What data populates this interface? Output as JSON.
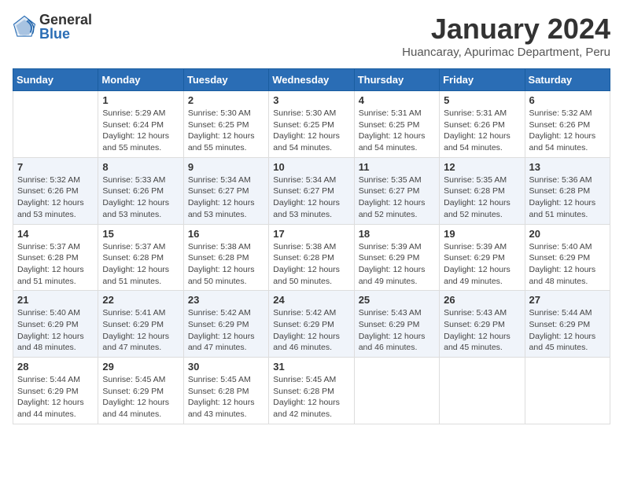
{
  "logo": {
    "general": "General",
    "blue": "Blue"
  },
  "title": "January 2024",
  "subtitle": "Huancaray, Apurimac Department, Peru",
  "days_of_week": [
    "Sunday",
    "Monday",
    "Tuesday",
    "Wednesday",
    "Thursday",
    "Friday",
    "Saturday"
  ],
  "weeks": [
    [
      {
        "day": "",
        "info": ""
      },
      {
        "day": "1",
        "info": "Sunrise: 5:29 AM\nSunset: 6:24 PM\nDaylight: 12 hours\nand 55 minutes."
      },
      {
        "day": "2",
        "info": "Sunrise: 5:30 AM\nSunset: 6:25 PM\nDaylight: 12 hours\nand 55 minutes."
      },
      {
        "day": "3",
        "info": "Sunrise: 5:30 AM\nSunset: 6:25 PM\nDaylight: 12 hours\nand 54 minutes."
      },
      {
        "day": "4",
        "info": "Sunrise: 5:31 AM\nSunset: 6:25 PM\nDaylight: 12 hours\nand 54 minutes."
      },
      {
        "day": "5",
        "info": "Sunrise: 5:31 AM\nSunset: 6:26 PM\nDaylight: 12 hours\nand 54 minutes."
      },
      {
        "day": "6",
        "info": "Sunrise: 5:32 AM\nSunset: 6:26 PM\nDaylight: 12 hours\nand 54 minutes."
      }
    ],
    [
      {
        "day": "7",
        "info": "Sunrise: 5:32 AM\nSunset: 6:26 PM\nDaylight: 12 hours\nand 53 minutes."
      },
      {
        "day": "8",
        "info": "Sunrise: 5:33 AM\nSunset: 6:26 PM\nDaylight: 12 hours\nand 53 minutes."
      },
      {
        "day": "9",
        "info": "Sunrise: 5:34 AM\nSunset: 6:27 PM\nDaylight: 12 hours\nand 53 minutes."
      },
      {
        "day": "10",
        "info": "Sunrise: 5:34 AM\nSunset: 6:27 PM\nDaylight: 12 hours\nand 53 minutes."
      },
      {
        "day": "11",
        "info": "Sunrise: 5:35 AM\nSunset: 6:27 PM\nDaylight: 12 hours\nand 52 minutes."
      },
      {
        "day": "12",
        "info": "Sunrise: 5:35 AM\nSunset: 6:28 PM\nDaylight: 12 hours\nand 52 minutes."
      },
      {
        "day": "13",
        "info": "Sunrise: 5:36 AM\nSunset: 6:28 PM\nDaylight: 12 hours\nand 51 minutes."
      }
    ],
    [
      {
        "day": "14",
        "info": "Sunrise: 5:37 AM\nSunset: 6:28 PM\nDaylight: 12 hours\nand 51 minutes."
      },
      {
        "day": "15",
        "info": "Sunrise: 5:37 AM\nSunset: 6:28 PM\nDaylight: 12 hours\nand 51 minutes."
      },
      {
        "day": "16",
        "info": "Sunrise: 5:38 AM\nSunset: 6:28 PM\nDaylight: 12 hours\nand 50 minutes."
      },
      {
        "day": "17",
        "info": "Sunrise: 5:38 AM\nSunset: 6:28 PM\nDaylight: 12 hours\nand 50 minutes."
      },
      {
        "day": "18",
        "info": "Sunrise: 5:39 AM\nSunset: 6:29 PM\nDaylight: 12 hours\nand 49 minutes."
      },
      {
        "day": "19",
        "info": "Sunrise: 5:39 AM\nSunset: 6:29 PM\nDaylight: 12 hours\nand 49 minutes."
      },
      {
        "day": "20",
        "info": "Sunrise: 5:40 AM\nSunset: 6:29 PM\nDaylight: 12 hours\nand 48 minutes."
      }
    ],
    [
      {
        "day": "21",
        "info": "Sunrise: 5:40 AM\nSunset: 6:29 PM\nDaylight: 12 hours\nand 48 minutes."
      },
      {
        "day": "22",
        "info": "Sunrise: 5:41 AM\nSunset: 6:29 PM\nDaylight: 12 hours\nand 47 minutes."
      },
      {
        "day": "23",
        "info": "Sunrise: 5:42 AM\nSunset: 6:29 PM\nDaylight: 12 hours\nand 47 minutes."
      },
      {
        "day": "24",
        "info": "Sunrise: 5:42 AM\nSunset: 6:29 PM\nDaylight: 12 hours\nand 46 minutes."
      },
      {
        "day": "25",
        "info": "Sunrise: 5:43 AM\nSunset: 6:29 PM\nDaylight: 12 hours\nand 46 minutes."
      },
      {
        "day": "26",
        "info": "Sunrise: 5:43 AM\nSunset: 6:29 PM\nDaylight: 12 hours\nand 45 minutes."
      },
      {
        "day": "27",
        "info": "Sunrise: 5:44 AM\nSunset: 6:29 PM\nDaylight: 12 hours\nand 45 minutes."
      }
    ],
    [
      {
        "day": "28",
        "info": "Sunrise: 5:44 AM\nSunset: 6:29 PM\nDaylight: 12 hours\nand 44 minutes."
      },
      {
        "day": "29",
        "info": "Sunrise: 5:45 AM\nSunset: 6:29 PM\nDaylight: 12 hours\nand 44 minutes."
      },
      {
        "day": "30",
        "info": "Sunrise: 5:45 AM\nSunset: 6:28 PM\nDaylight: 12 hours\nand 43 minutes."
      },
      {
        "day": "31",
        "info": "Sunrise: 5:45 AM\nSunset: 6:28 PM\nDaylight: 12 hours\nand 42 minutes."
      },
      {
        "day": "",
        "info": ""
      },
      {
        "day": "",
        "info": ""
      },
      {
        "day": "",
        "info": ""
      }
    ]
  ]
}
